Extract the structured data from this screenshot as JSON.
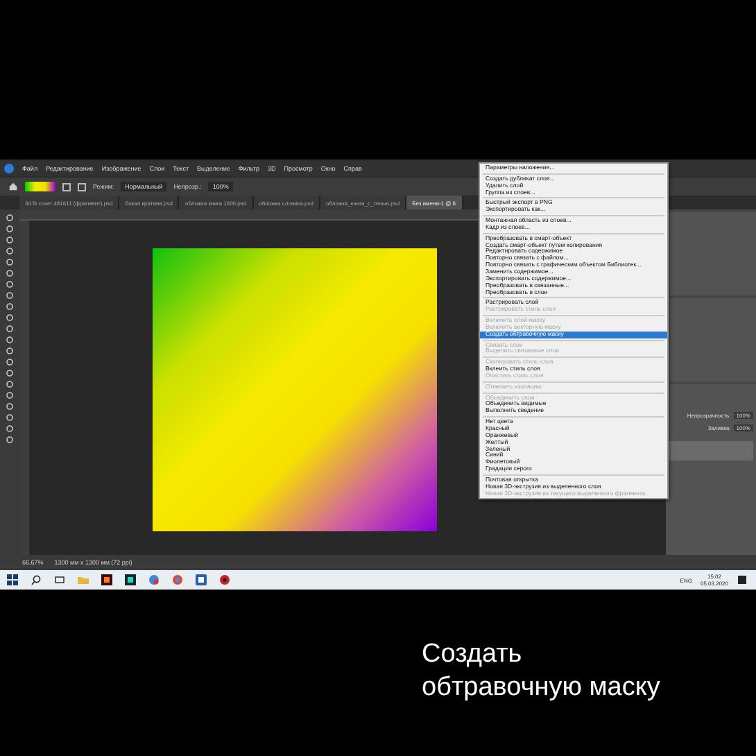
{
  "menubar": [
    "Файл",
    "Редактирование",
    "Изображение",
    "Слои",
    "Текст",
    "Выделение",
    "Фильтр",
    "3D",
    "Просмотр",
    "Окно",
    "Справ"
  ],
  "options": {
    "mode_label": "Режим:",
    "mode_value": "Нормальный",
    "opacity_label": "Непрозр.:",
    "opacity_value": "100%"
  },
  "tabs": [
    {
      "label": "3d fit cover 481611 (фрагмент).psd",
      "selected": false
    },
    {
      "label": "бокал кратина.psd",
      "selected": false
    },
    {
      "label": "обложка книга 1600.psd",
      "selected": false
    },
    {
      "label": "обложка слоника.psd",
      "selected": false
    },
    {
      "label": "обложка_книги_с_тенью.psd",
      "selected": false
    },
    {
      "label": "Без имени-1 @ 6",
      "selected": true
    }
  ],
  "status_bar": {
    "zoom": "66,67%",
    "info": "1300 мм x 1300 мм (72 ppi)"
  },
  "layers_panel": {
    "opacity_label": "Непрозрачность:",
    "opacity_value": "100%",
    "fill_label": "Заливка:",
    "fill_value": "100%"
  },
  "context_menu": {
    "groups": [
      [
        {
          "label": "Параметры наложения...",
          "disabled": false,
          "selected": false
        }
      ],
      [
        {
          "label": "Создать дубликат слоя...",
          "disabled": false,
          "selected": false
        },
        {
          "label": "Удалить слой",
          "disabled": false,
          "selected": false
        },
        {
          "label": "Группа из слоев...",
          "disabled": false,
          "selected": false
        }
      ],
      [
        {
          "label": "Быстрый экспорт в PNG",
          "disabled": false,
          "selected": false
        },
        {
          "label": "Экспортировать как...",
          "disabled": false,
          "selected": false
        }
      ],
      [
        {
          "label": "Монтажная область из слоев...",
          "disabled": false,
          "selected": false
        },
        {
          "label": "Кадр из слоев...",
          "disabled": false,
          "selected": false
        }
      ],
      [
        {
          "label": "Преобразовать в смарт-объект",
          "disabled": false,
          "selected": false
        },
        {
          "label": "Создать смарт-объект путем копирования",
          "disabled": false,
          "selected": false
        },
        {
          "label": "Редактировать содержимое",
          "disabled": false,
          "selected": false
        },
        {
          "label": "Повторно связать с файлом...",
          "disabled": false,
          "selected": false
        },
        {
          "label": "Повторно связать с графическим объектом Библиотек...",
          "disabled": false,
          "selected": false
        },
        {
          "label": "Заменить содержимое...",
          "disabled": false,
          "selected": false
        },
        {
          "label": "Экспортировать содержимое...",
          "disabled": false,
          "selected": false
        },
        {
          "label": "Преобразовать в связанные...",
          "disabled": false,
          "selected": false
        },
        {
          "label": "Преобразовать в слои",
          "disabled": false,
          "selected": false
        }
      ],
      [
        {
          "label": "Растрировать слой",
          "disabled": false,
          "selected": false
        },
        {
          "label": "Растрировать стиль слоя",
          "disabled": true,
          "selected": false
        }
      ],
      [
        {
          "label": "Включить слой-маску",
          "disabled": true,
          "selected": false
        },
        {
          "label": "Включить векторную маску",
          "disabled": true,
          "selected": false
        },
        {
          "label": "Создать обтравочную маску",
          "disabled": false,
          "selected": true
        }
      ],
      [
        {
          "label": "Связать слои",
          "disabled": true,
          "selected": false
        },
        {
          "label": "Выделить связанные слои",
          "disabled": true,
          "selected": false
        }
      ],
      [
        {
          "label": "Скопировать стиль слоя",
          "disabled": true,
          "selected": false
        },
        {
          "label": "Вклеить стиль слоя",
          "disabled": false,
          "selected": false
        },
        {
          "label": "Очистить стиль слоя",
          "disabled": true,
          "selected": false
        }
      ],
      [
        {
          "label": "Отменить изоляцию",
          "disabled": true,
          "selected": false
        }
      ],
      [
        {
          "label": "Объединить слои",
          "disabled": true,
          "selected": false
        },
        {
          "label": "Объединить видимые",
          "disabled": false,
          "selected": false
        },
        {
          "label": "Выполнить сведение",
          "disabled": false,
          "selected": false
        }
      ],
      [
        {
          "label": "Нет цвета",
          "disabled": false,
          "selected": false
        },
        {
          "label": "Красный",
          "disabled": false,
          "selected": false
        },
        {
          "label": "Оранжевый",
          "disabled": false,
          "selected": false
        },
        {
          "label": "Желтый",
          "disabled": false,
          "selected": false
        },
        {
          "label": "Зеленый",
          "disabled": false,
          "selected": false
        },
        {
          "label": "Синий",
          "disabled": false,
          "selected": false
        },
        {
          "label": "Фиолетовый",
          "disabled": false,
          "selected": false
        },
        {
          "label": "Градации серого",
          "disabled": false,
          "selected": false
        }
      ],
      [
        {
          "label": "Почтовая открытка",
          "disabled": false,
          "selected": false
        },
        {
          "label": "Новая 3D-экструзия из выделенного слоя",
          "disabled": false,
          "selected": false
        },
        {
          "label": "Новая 3D-экструзия из текущего выделенного фрагмента",
          "disabled": true,
          "selected": false
        }
      ]
    ]
  },
  "taskbar": {
    "lang": "ENG",
    "time": "15:02",
    "date": "05.03.2020"
  },
  "caption": [
    "Создать",
    "обтравочную маску"
  ]
}
